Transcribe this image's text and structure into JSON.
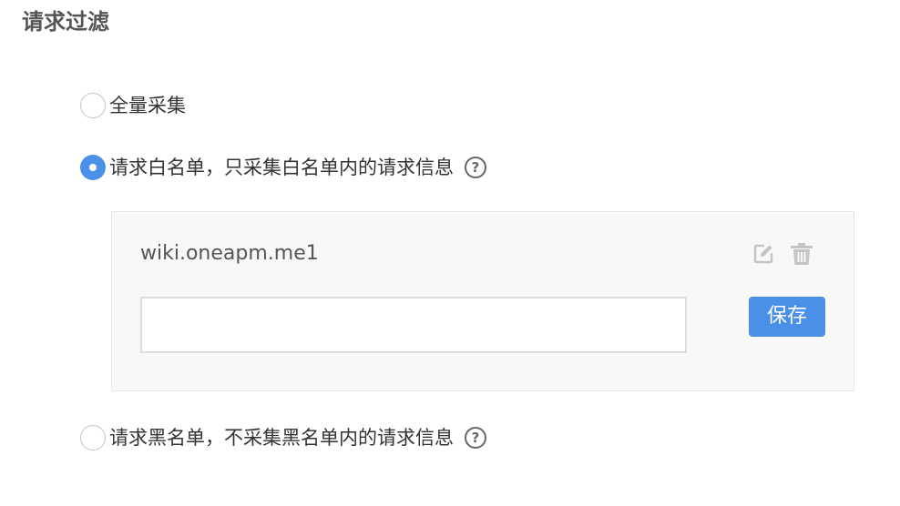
{
  "section": {
    "title": "请求过滤"
  },
  "options": {
    "all": {
      "label": "全量采集",
      "checked": false
    },
    "whitelist": {
      "label": "请求白名单，只采集白名单内的请求信息",
      "checked": true,
      "help_icon": "help-circle-icon",
      "help_glyph": "?"
    },
    "blacklist": {
      "label": "请求黑名单，不采集黑名单内的请求信息",
      "checked": false,
      "help_icon": "help-circle-icon",
      "help_glyph": "?"
    }
  },
  "whitelist_panel": {
    "entry": "wiki.oneapm.me1",
    "edit_icon": "edit-icon",
    "delete_icon": "trash-icon",
    "input_value": "",
    "save_label": "保存"
  },
  "colors": {
    "accent": "#4a90e8",
    "panel_bg": "#f8f8f8",
    "icon_gray": "#c4c4c4"
  }
}
